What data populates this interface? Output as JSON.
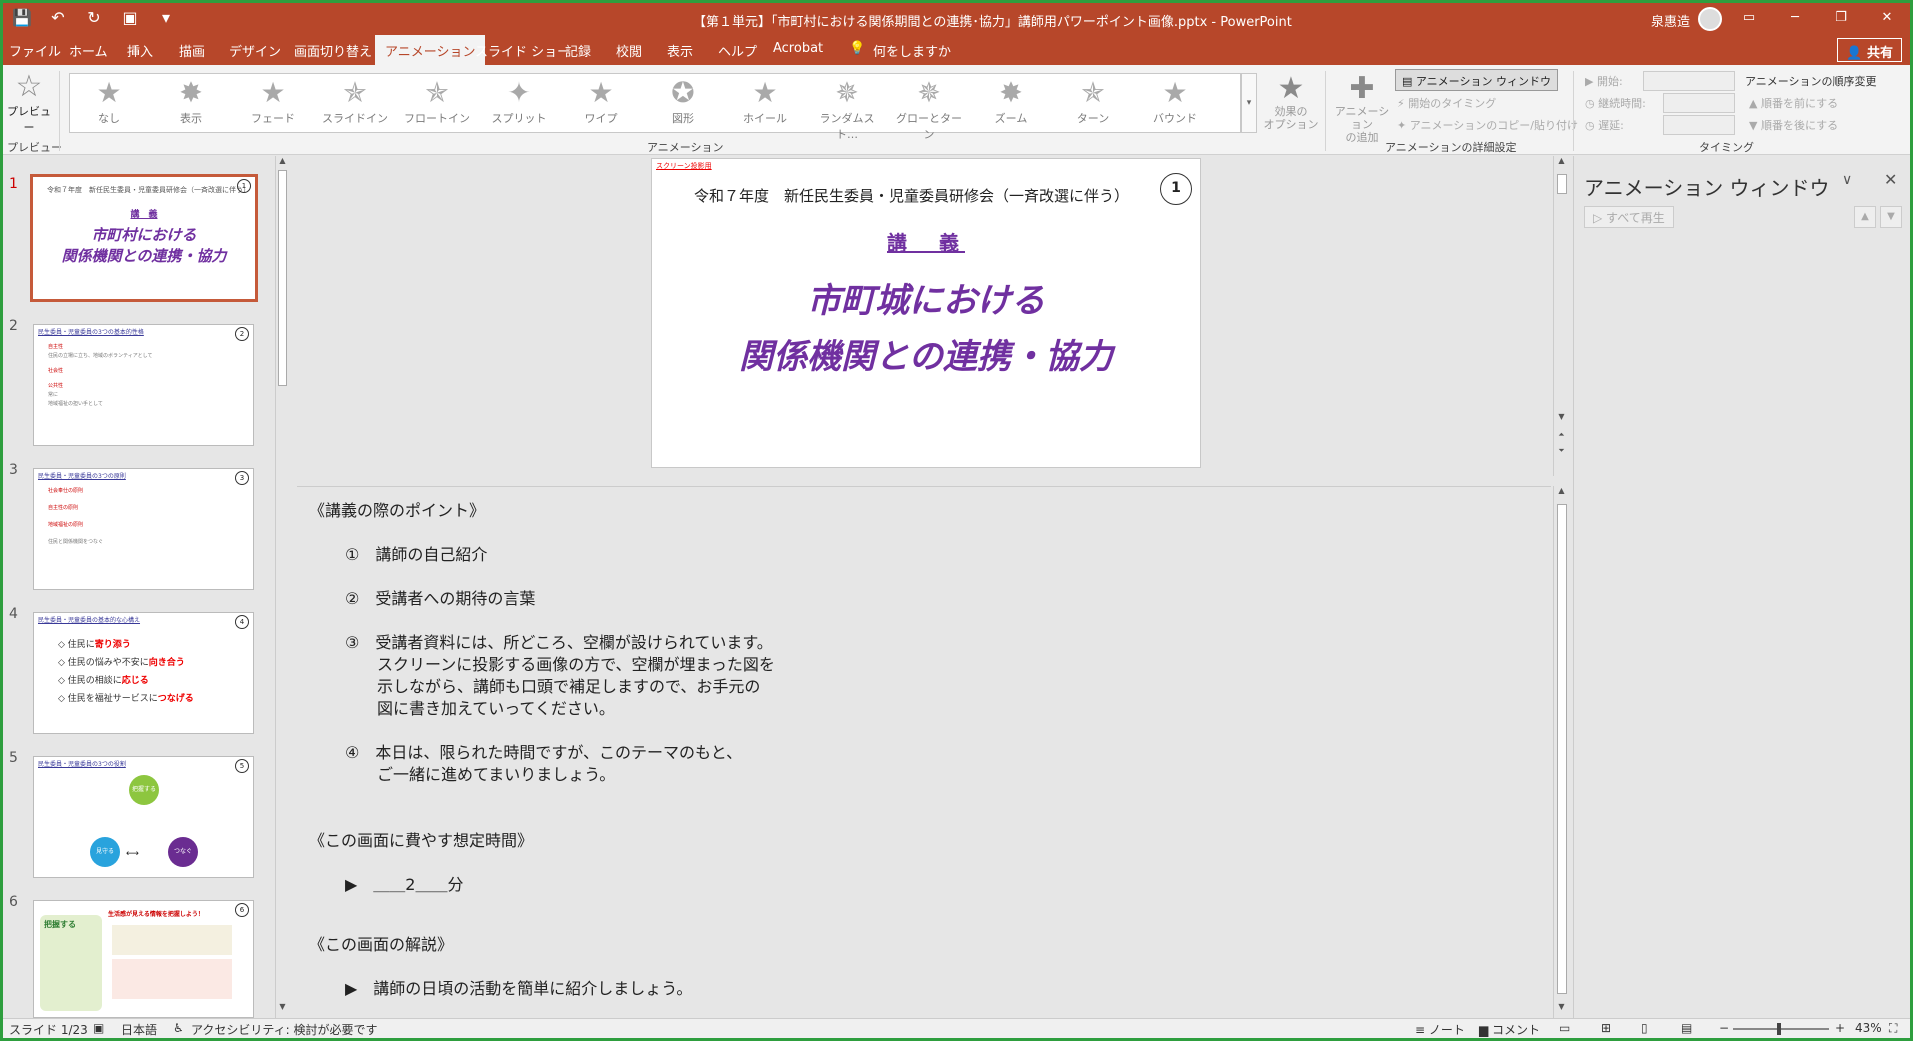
{
  "titlebar": {
    "title": "【第１単元】「市町村における関係期間との連携･協力」講師用パワーポイント画像.pptx  -  PowerPoint",
    "user": "泉惠造",
    "qat": [
      "save-icon",
      "undo-icon",
      "redo-icon",
      "present-icon",
      "customize-icon"
    ],
    "buttons": [
      "ribbon-display-icon",
      "minimize-icon",
      "restore-icon",
      "close-icon"
    ],
    "button_glyphs": [
      "▭",
      "─",
      "❐",
      "✕"
    ]
  },
  "tabs": [
    "ファイル",
    "ホーム",
    "挿入",
    "描画",
    "デザイン",
    "画面切り替え",
    "アニメーション",
    "スライド ショー",
    "記録",
    "校閲",
    "表示",
    "ヘルプ",
    "Acrobat",
    "何をしますか"
  ],
  "active_tab": "アニメーション",
  "share": "共有",
  "ribbon": {
    "preview": {
      "label": "プレビュー",
      "group": "プレビュー"
    },
    "animations": [
      {
        "label": "なし",
        "glyph": "★"
      },
      {
        "label": "表示",
        "glyph": "✸"
      },
      {
        "label": "フェード",
        "glyph": "★"
      },
      {
        "label": "スライドイン",
        "glyph": "✯"
      },
      {
        "label": "フロートイン",
        "glyph": "✯"
      },
      {
        "label": "スプリット",
        "glyph": "✦"
      },
      {
        "label": "ワイプ",
        "glyph": "★"
      },
      {
        "label": "図形",
        "glyph": "✪"
      },
      {
        "label": "ホイール",
        "glyph": "★"
      },
      {
        "label": "ランダムスト…",
        "glyph": "✵"
      },
      {
        "label": "グローとターン",
        "glyph": "✵"
      },
      {
        "label": "ズーム",
        "glyph": "✸"
      },
      {
        "label": "ターン",
        "glyph": "✯"
      },
      {
        "label": "バウンド",
        "glyph": "★"
      }
    ],
    "animation_group": "アニメーション",
    "effect_options": "効果の\nオプション",
    "add_animation": "アニメーション\nの追加",
    "animation_pane": "アニメーション ウィンドウ",
    "start_trigger": "開始のタイミング",
    "copy_anim": "アニメーションのコピー/貼り付け",
    "detail_group": "アニメーションの詳細設定",
    "timing": {
      "start": "開始:",
      "duration": "継続時間:",
      "delay": "遅延:",
      "reorder": "アニメーションの順序変更",
      "earlier": "順番を前にする",
      "later": "順番を後にする",
      "group": "タイミング"
    }
  },
  "slides": [
    {
      "num": "1",
      "header": "令和７年度　新任民生委員・児童委員研修会（一斉改選に伴う）",
      "sub": "講　義",
      "main": [
        "市町村における",
        "関係機関との連携・協力"
      ],
      "badge": "1"
    },
    {
      "num": "2",
      "title": "民生委員・児童委員の3つの基本的性格",
      "body": [
        "自主性",
        "住民の立場に立ち、地域のボランティアとして",
        "社会性",
        "公共性",
        "常に",
        "地域福祉の担い手として"
      ]
    },
    {
      "num": "3",
      "title": "民生委員・児童委員の3つの原則",
      "body": [
        "社会奉仕の原則",
        "自主性の原則",
        "地域福祉の原則",
        "住民と関係機関をつなぐ"
      ]
    },
    {
      "num": "4",
      "title": "民生委員・児童委員の基本的な心構え",
      "items": [
        {
          "pre": "◇ 住民に",
          "em": "寄り添う"
        },
        {
          "pre": "◇ 住民の悩みや不安に",
          "em": "向き合う"
        },
        {
          "pre": "◇ 住民の相談に",
          "em": "応じる"
        },
        {
          "pre": "◇ 住民を福祉サービスに",
          "em": "つなげる"
        }
      ]
    },
    {
      "num": "5",
      "title": "民生委員・児童委員の3つの役割",
      "circles": [
        "把握する",
        "見守る",
        "つなぐ"
      ]
    },
    {
      "num": "6",
      "title": "把握する",
      "right": "生活感が見える情報を把握しよう！"
    }
  ],
  "slide": {
    "red_label": "スクリーン投影用",
    "header": "令和７年度　新任民生委員・児童委員研修会（一斉改選に伴う）",
    "badge": "1",
    "subtitle": "講　義",
    "main_line1": "市町城における",
    "main_line2": "関係機関との連携・協力"
  },
  "notes": {
    "points_title": "《講義の際のポイント》",
    "items": [
      "①　講師の自己紹介",
      "②　受講者への期待の言葉",
      "③　受講者資料には、所どころ、空欄が設けられています。",
      "スクリーンに投影する画像の方で、空欄が埋まった図を",
      "示しながら、講師も口頭で補足しますので、お手元の",
      "図に書き加えていってください。",
      "④　本日は、限られた時間ですが、このテーマのもと、",
      "ご一緒に進めてまいりましょう。"
    ],
    "time_title": "《この画面に費やす想定時間》",
    "time_value": "▶　＿＿2＿＿分",
    "explain_title": "《この画面の解説》",
    "explain_value": "▶　講師の日頃の活動を簡単に紹介しましょう。"
  },
  "pane": {
    "title": "アニメーション ウィンドウ",
    "play_all": "▷ すべて再生"
  },
  "status": {
    "slide": "スライド 1/23",
    "lang": "日本語",
    "access": "アクセシビリティ: 検討が必要です",
    "notes": "ノート",
    "comments": "コメント",
    "zoom": "43%"
  }
}
